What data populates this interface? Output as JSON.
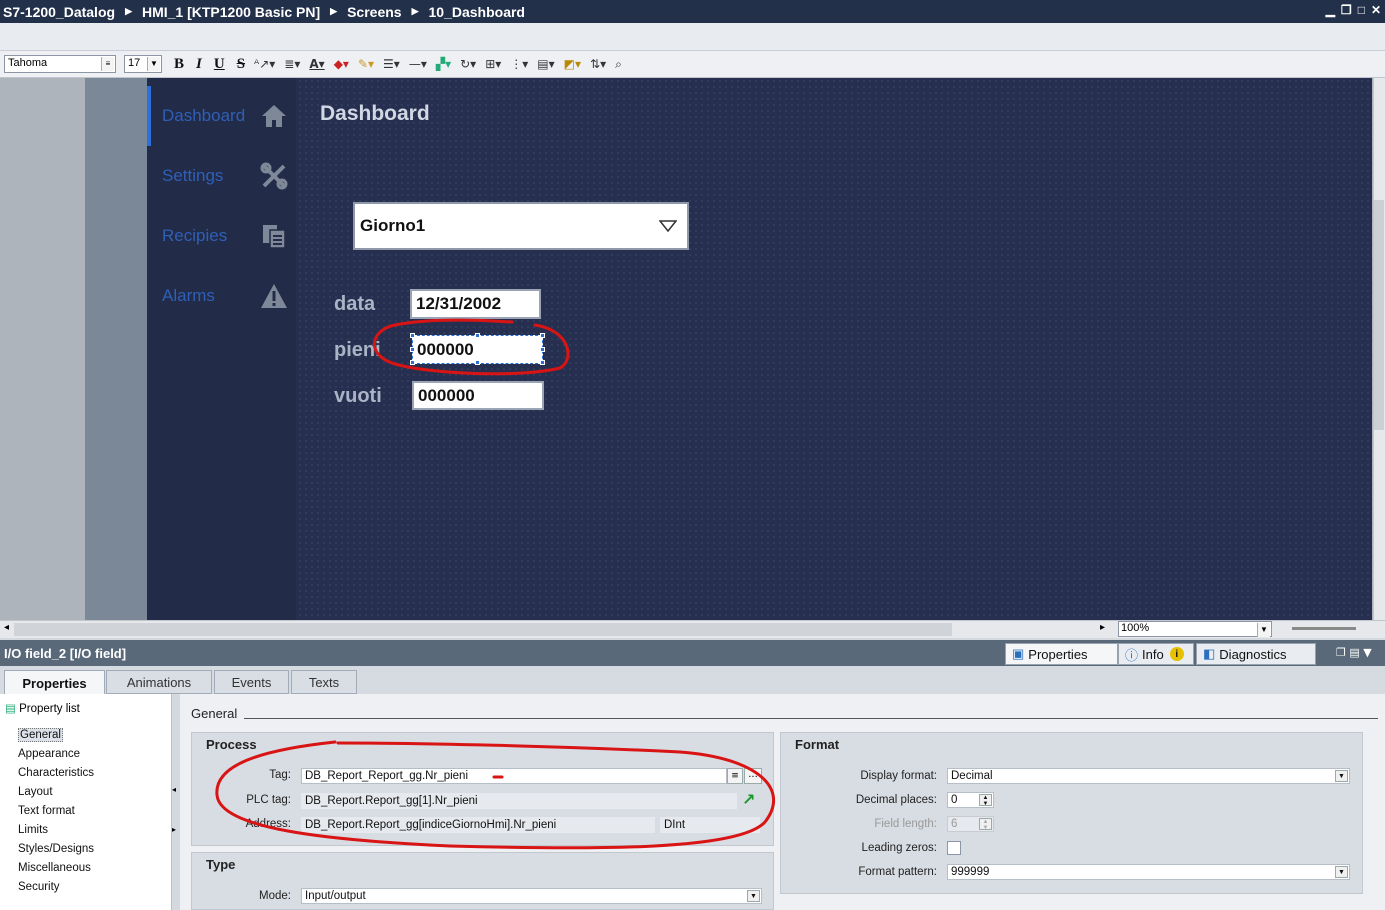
{
  "breadcrumb": [
    "S7-1200_Datalog",
    "HMI_1 [KTP1200 Basic PN]",
    "Screens",
    "10_Dashboard"
  ],
  "toolbar": {
    "font": "Tahoma",
    "size": "17"
  },
  "nav": {
    "items": [
      {
        "label": "Dashboard"
      },
      {
        "label": "Settings"
      },
      {
        "label": "Recipies"
      },
      {
        "label": "Alarms"
      }
    ]
  },
  "screen": {
    "title": "Dashboard",
    "combo_value": "Giorno1",
    "fields": [
      {
        "label": "data",
        "value": "12/31/2002"
      },
      {
        "label": "pieni",
        "value": "000000"
      },
      {
        "label": "vuoti",
        "value": "000000"
      }
    ]
  },
  "zoom": "100%",
  "inspector": {
    "object": "I/O field_2 [I/O field]",
    "tabs": [
      "Properties",
      "Info",
      "Diagnostics"
    ],
    "subtabs": [
      "Properties",
      "Animations",
      "Events",
      "Texts"
    ],
    "property_list_label": "Property list",
    "property_list": [
      "General",
      "Appearance",
      "Characteristics",
      "Layout",
      "Text format",
      "Limits",
      "Styles/Designs",
      "Miscellaneous",
      "Security"
    ],
    "section_heading": "General",
    "process": {
      "title": "Process",
      "tag_label": "Tag:",
      "tag": "DB_Report_Report_gg.Nr_pieni",
      "plc_tag_label": "PLC tag:",
      "plc_tag": "DB_Report.Report_gg[1].Nr_pieni",
      "address_label": "Address:",
      "address": "DB_Report.Report_gg[indiceGiornoHmi].Nr_pieni",
      "datatype": "DInt"
    },
    "type": {
      "title": "Type",
      "mode_label": "Mode:",
      "mode": "Input/output"
    },
    "format": {
      "title": "Format",
      "display_format_label": "Display format:",
      "display_format": "Decimal",
      "decimal_places_label": "Decimal places:",
      "decimal_places": "0",
      "field_length_label": "Field length:",
      "field_length": "6",
      "leading_zeros_label": "Leading zeros:",
      "format_pattern_label": "Format pattern:",
      "format_pattern": "999999"
    }
  },
  "colors": {
    "accent": "#2f6fd8",
    "hmi_bg": "#262f4f",
    "annotation": "#d81414"
  }
}
